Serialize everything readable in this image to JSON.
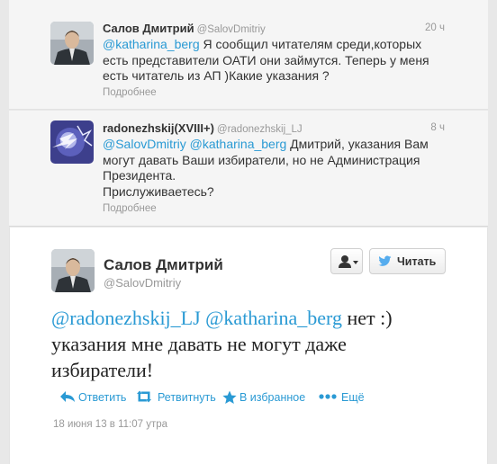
{
  "tweets": {
    "first": {
      "fullname": "Салов Дмитрий",
      "screen_name": "@SalovDmitriy",
      "time": "20 ч",
      "mention1": "@katharina_berg",
      "text_line1": " Я сообщил читателям среди,которых",
      "text_line2": "есть представители ОАТИ они займутся. Теперь у меня",
      "text_line3": "есть читатель из АП )Какие указания ?",
      "more": "Подробнее"
    },
    "second": {
      "fullname": "radonezhskij(XVIII+)",
      "screen_name": "@radonezhskij_LJ",
      "time": "8 ч",
      "mention1": "@SalovDmitriy",
      "mention2": "@katharina_berg",
      "text_line1": " Дмитрий, указания Вам",
      "text_line2": "могут давать Ваши избиратели, но не Администрация",
      "text_line3": "Президента.",
      "text_line4": "Прислуживаетесь?",
      "more": "Подробнее"
    },
    "main": {
      "fullname": "Салов Дмитрий",
      "screen_name": "@SalovDmitriy",
      "follow_label": "Читать",
      "mention1": "@radonezhskij_LJ",
      "mention2": "@katharina_berg",
      "text_part1": " нет :)",
      "text_line2": "указания мне давать не могут даже",
      "text_line3": "избиратели!",
      "actions": {
        "reply": "Ответить",
        "retweet": "Ретвитнуть",
        "favorite": "В избранное",
        "more": "Ещё"
      },
      "timestamp": "18 июня 13 в 11:07 утра"
    }
  },
  "colors": {
    "link": "#2a9ad4",
    "muted": "#999999",
    "context_bg": "#f5f5f5",
    "page_bg": "#e8e8e8",
    "twitter_bird": "#55acee"
  },
  "icons": [
    "user-dropdown-icon",
    "twitter-bird-icon",
    "reply-icon",
    "retweet-icon",
    "star-icon",
    "more-dots-icon"
  ]
}
